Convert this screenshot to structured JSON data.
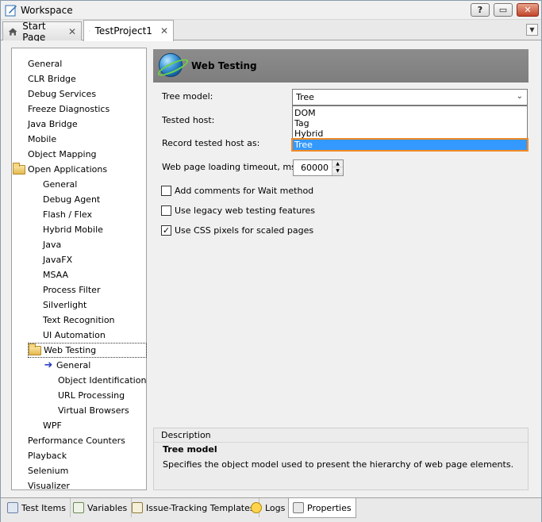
{
  "window": {
    "title": "Workspace",
    "controls": {
      "help": "?",
      "restore": "▭",
      "close": "✕"
    }
  },
  "tabs": [
    {
      "label": "Start Page",
      "icon": "home-icon",
      "close": "✕"
    },
    {
      "label": "TestProject1",
      "icon": "project-icon",
      "close": "✕"
    }
  ],
  "tab_menu_icon": "chevron-down-icon",
  "tree": {
    "items": [
      {
        "label": "General",
        "level": 0
      },
      {
        "label": "CLR Bridge",
        "level": 0
      },
      {
        "label": "Debug Services",
        "level": 0
      },
      {
        "label": "Freeze Diagnostics",
        "level": 0
      },
      {
        "label": "Java Bridge",
        "level": 0
      },
      {
        "label": "Mobile",
        "level": 0
      },
      {
        "label": "Object Mapping",
        "level": 0
      },
      {
        "label": "Open Applications",
        "level": 0,
        "icon": "folder-open-icon"
      },
      {
        "label": "General",
        "level": 1
      },
      {
        "label": "Debug Agent",
        "level": 1
      },
      {
        "label": "Flash / Flex",
        "level": 1
      },
      {
        "label": "Hybrid Mobile",
        "level": 1
      },
      {
        "label": "Java",
        "level": 1
      },
      {
        "label": "JavaFX",
        "level": 1
      },
      {
        "label": "MSAA",
        "level": 1
      },
      {
        "label": "Process Filter",
        "level": 1
      },
      {
        "label": "Silverlight",
        "level": 1
      },
      {
        "label": "Text Recognition",
        "level": 1
      },
      {
        "label": "UI Automation",
        "level": 1
      },
      {
        "label": "Web Testing",
        "level": 1,
        "icon": "folder-open-icon",
        "selected": true
      },
      {
        "label": "General",
        "level": 2,
        "icon": "arrow-right-icon"
      },
      {
        "label": "Object Identification",
        "level": 2
      },
      {
        "label": "URL Processing",
        "level": 2
      },
      {
        "label": "Virtual Browsers",
        "level": 2
      },
      {
        "label": "WPF",
        "level": 1
      },
      {
        "label": "Performance Counters",
        "level": 0
      },
      {
        "label": "Playback",
        "level": 0
      },
      {
        "label": "Selenium",
        "level": 0
      },
      {
        "label": "Visualizer",
        "level": 0
      }
    ]
  },
  "panel": {
    "title": "Web Testing",
    "tree_model_label": "Tree model:",
    "tree_model_value": "Tree",
    "tree_model_options": [
      "DOM",
      "Tag",
      "Hybrid",
      "Tree"
    ],
    "tested_host_label": "Tested host:",
    "record_host_label": "Record tested host as:",
    "timeout_label": "Web page loading timeout, ms:",
    "timeout_value": "60000",
    "checkboxes": [
      {
        "label": "Add comments for Wait method",
        "checked": false
      },
      {
        "label": "Use legacy web testing features",
        "checked": false
      },
      {
        "label": "Use CSS pixels for scaled pages",
        "checked": true
      }
    ]
  },
  "description": {
    "caption": "Description",
    "title": "Tree model",
    "text": "Specifies the object model used to present the hierarchy of web page elements."
  },
  "bottom_tabs": [
    {
      "label": "Test Items"
    },
    {
      "label": "Variables"
    },
    {
      "label": "Issue-Tracking Templates"
    },
    {
      "label": "Logs"
    },
    {
      "label": "Properties",
      "active": true
    }
  ],
  "colors": {
    "header_bg": "#848484",
    "selection": "#3399ff",
    "highlight_outline": "#f08a24"
  }
}
